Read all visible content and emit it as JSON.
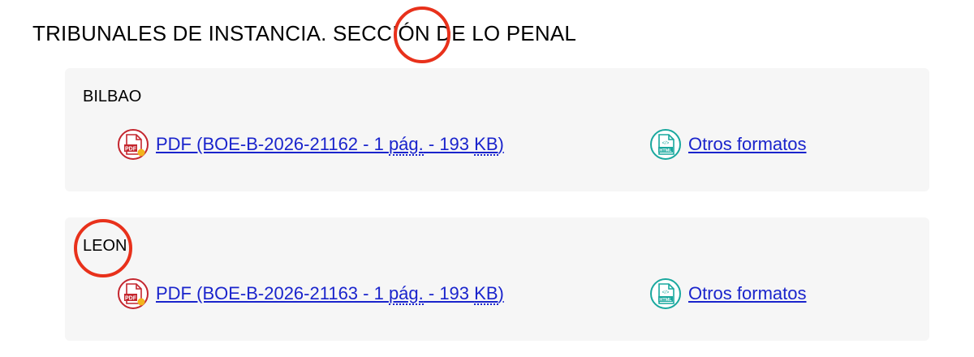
{
  "section": {
    "title": "TRIBUNALES DE INSTANCIA. SECCIÓN DE LO PENAL"
  },
  "entries": [
    {
      "city": "BILBAO",
      "pdf_prefix": "PDF (BOE-B-2026-21162 - 1 ",
      "pdf_abbr1": "pág.",
      "pdf_mid": " - 193 ",
      "pdf_abbr2": "KB",
      "pdf_suffix": ")",
      "other_formats": "Otros formatos"
    },
    {
      "city": "LEON",
      "pdf_prefix": "PDF (BOE-B-2026-21163 - 1 ",
      "pdf_abbr1": "pág.",
      "pdf_mid": " - 193 ",
      "pdf_abbr2": "KB",
      "pdf_suffix": ")",
      "other_formats": "Otros formatos"
    }
  ],
  "icons": {
    "pdf": "pdf-document-icon",
    "html": "html-document-icon"
  },
  "colors": {
    "link": "#1a24cc",
    "card_bg": "#f6f6f6",
    "pdf_icon": "#c4262e",
    "html_icon": "#19a89e",
    "annotation": "#e8311b"
  }
}
